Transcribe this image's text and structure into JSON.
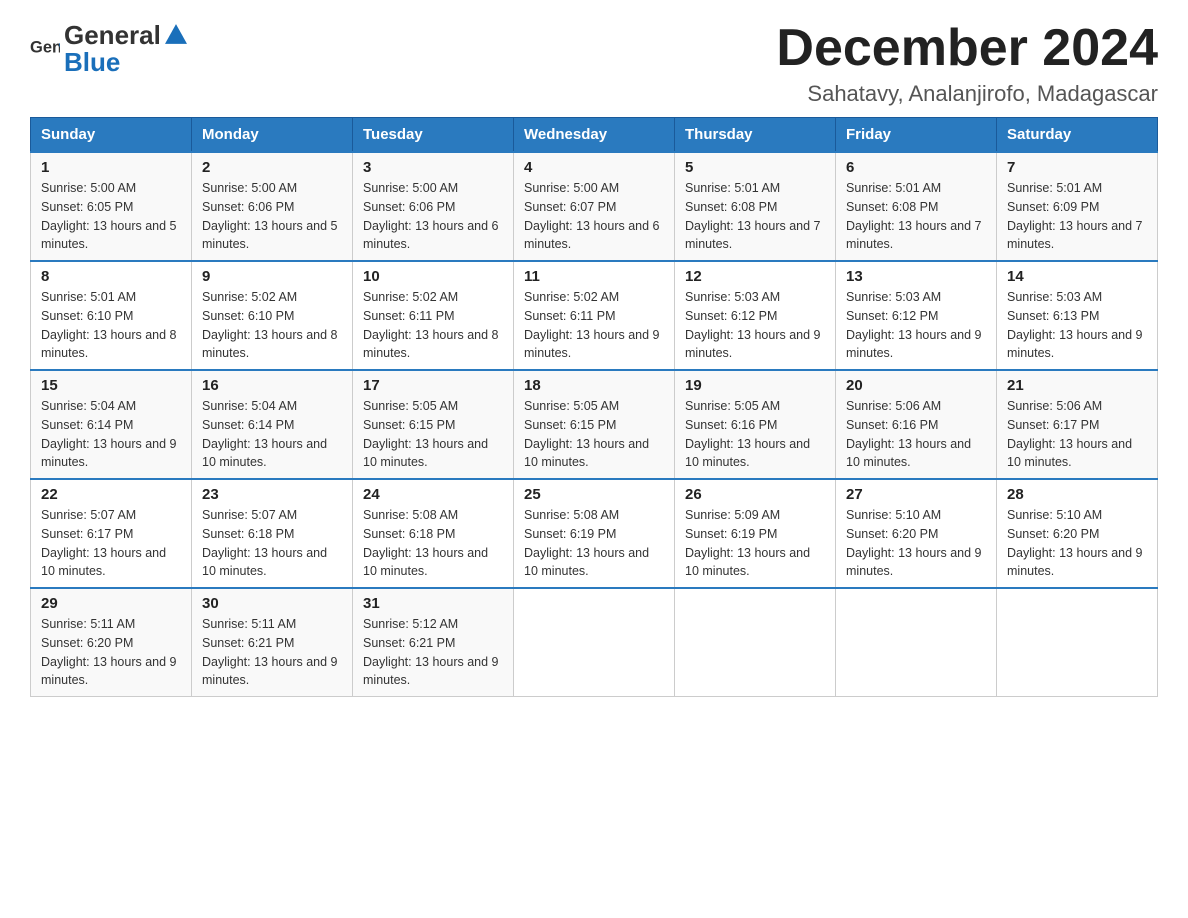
{
  "header": {
    "logo_line1": "General",
    "logo_line2": "Blue",
    "title": "December 2024",
    "subtitle": "Sahatavy, Analanjirofo, Madagascar"
  },
  "days_of_week": [
    "Sunday",
    "Monday",
    "Tuesday",
    "Wednesday",
    "Thursday",
    "Friday",
    "Saturday"
  ],
  "weeks": [
    [
      {
        "day": "1",
        "sunrise": "5:00 AM",
        "sunset": "6:05 PM",
        "daylight": "13 hours and 5 minutes."
      },
      {
        "day": "2",
        "sunrise": "5:00 AM",
        "sunset": "6:06 PM",
        "daylight": "13 hours and 5 minutes."
      },
      {
        "day": "3",
        "sunrise": "5:00 AM",
        "sunset": "6:06 PM",
        "daylight": "13 hours and 6 minutes."
      },
      {
        "day": "4",
        "sunrise": "5:00 AM",
        "sunset": "6:07 PM",
        "daylight": "13 hours and 6 minutes."
      },
      {
        "day": "5",
        "sunrise": "5:01 AM",
        "sunset": "6:08 PM",
        "daylight": "13 hours and 7 minutes."
      },
      {
        "day": "6",
        "sunrise": "5:01 AM",
        "sunset": "6:08 PM",
        "daylight": "13 hours and 7 minutes."
      },
      {
        "day": "7",
        "sunrise": "5:01 AM",
        "sunset": "6:09 PM",
        "daylight": "13 hours and 7 minutes."
      }
    ],
    [
      {
        "day": "8",
        "sunrise": "5:01 AM",
        "sunset": "6:10 PM",
        "daylight": "13 hours and 8 minutes."
      },
      {
        "day": "9",
        "sunrise": "5:02 AM",
        "sunset": "6:10 PM",
        "daylight": "13 hours and 8 minutes."
      },
      {
        "day": "10",
        "sunrise": "5:02 AM",
        "sunset": "6:11 PM",
        "daylight": "13 hours and 8 minutes."
      },
      {
        "day": "11",
        "sunrise": "5:02 AM",
        "sunset": "6:11 PM",
        "daylight": "13 hours and 9 minutes."
      },
      {
        "day": "12",
        "sunrise": "5:03 AM",
        "sunset": "6:12 PM",
        "daylight": "13 hours and 9 minutes."
      },
      {
        "day": "13",
        "sunrise": "5:03 AM",
        "sunset": "6:12 PM",
        "daylight": "13 hours and 9 minutes."
      },
      {
        "day": "14",
        "sunrise": "5:03 AM",
        "sunset": "6:13 PM",
        "daylight": "13 hours and 9 minutes."
      }
    ],
    [
      {
        "day": "15",
        "sunrise": "5:04 AM",
        "sunset": "6:14 PM",
        "daylight": "13 hours and 9 minutes."
      },
      {
        "day": "16",
        "sunrise": "5:04 AM",
        "sunset": "6:14 PM",
        "daylight": "13 hours and 10 minutes."
      },
      {
        "day": "17",
        "sunrise": "5:05 AM",
        "sunset": "6:15 PM",
        "daylight": "13 hours and 10 minutes."
      },
      {
        "day": "18",
        "sunrise": "5:05 AM",
        "sunset": "6:15 PM",
        "daylight": "13 hours and 10 minutes."
      },
      {
        "day": "19",
        "sunrise": "5:05 AM",
        "sunset": "6:16 PM",
        "daylight": "13 hours and 10 minutes."
      },
      {
        "day": "20",
        "sunrise": "5:06 AM",
        "sunset": "6:16 PM",
        "daylight": "13 hours and 10 minutes."
      },
      {
        "day": "21",
        "sunrise": "5:06 AM",
        "sunset": "6:17 PM",
        "daylight": "13 hours and 10 minutes."
      }
    ],
    [
      {
        "day": "22",
        "sunrise": "5:07 AM",
        "sunset": "6:17 PM",
        "daylight": "13 hours and 10 minutes."
      },
      {
        "day": "23",
        "sunrise": "5:07 AM",
        "sunset": "6:18 PM",
        "daylight": "13 hours and 10 minutes."
      },
      {
        "day": "24",
        "sunrise": "5:08 AM",
        "sunset": "6:18 PM",
        "daylight": "13 hours and 10 minutes."
      },
      {
        "day": "25",
        "sunrise": "5:08 AM",
        "sunset": "6:19 PM",
        "daylight": "13 hours and 10 minutes."
      },
      {
        "day": "26",
        "sunrise": "5:09 AM",
        "sunset": "6:19 PM",
        "daylight": "13 hours and 10 minutes."
      },
      {
        "day": "27",
        "sunrise": "5:10 AM",
        "sunset": "6:20 PM",
        "daylight": "13 hours and 9 minutes."
      },
      {
        "day": "28",
        "sunrise": "5:10 AM",
        "sunset": "6:20 PM",
        "daylight": "13 hours and 9 minutes."
      }
    ],
    [
      {
        "day": "29",
        "sunrise": "5:11 AM",
        "sunset": "6:20 PM",
        "daylight": "13 hours and 9 minutes."
      },
      {
        "day": "30",
        "sunrise": "5:11 AM",
        "sunset": "6:21 PM",
        "daylight": "13 hours and 9 minutes."
      },
      {
        "day": "31",
        "sunrise": "5:12 AM",
        "sunset": "6:21 PM",
        "daylight": "13 hours and 9 minutes."
      },
      null,
      null,
      null,
      null
    ]
  ]
}
